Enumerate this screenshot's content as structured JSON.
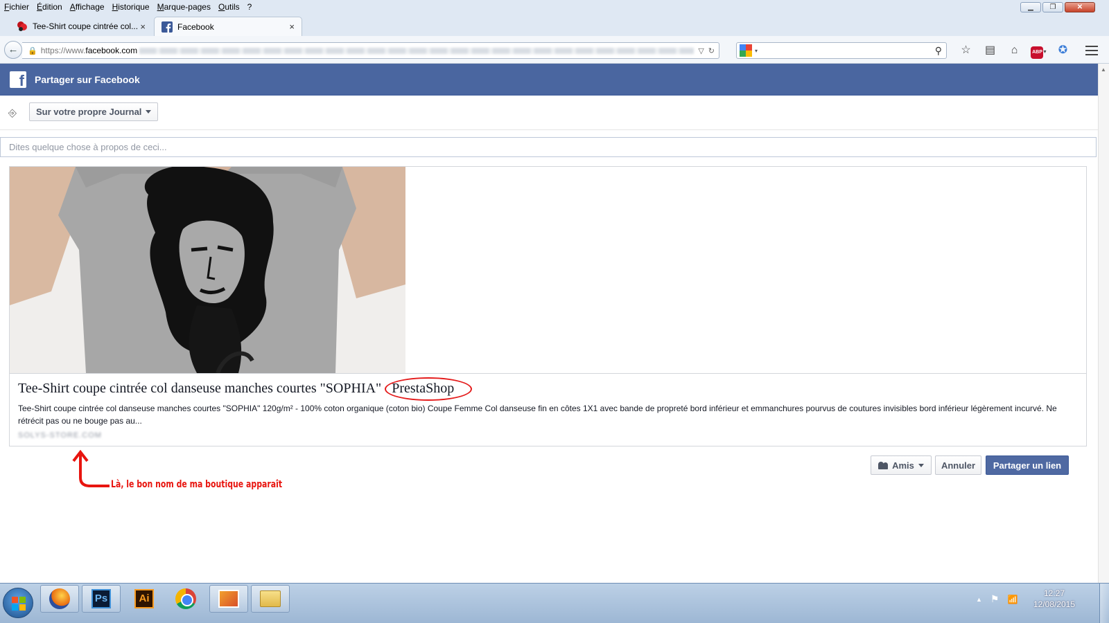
{
  "browser": {
    "menu": [
      "Fichier",
      "Édition",
      "Affichage",
      "Historique",
      "Marque-pages",
      "Outils",
      "?"
    ],
    "tabs": [
      {
        "label": "Tee-Shirt coupe cintrée col...",
        "close": "×"
      },
      {
        "label": "Facebook",
        "close": "×"
      }
    ],
    "new_tab": "+",
    "url_prefix": "https://www.",
    "url_host": "facebook.com",
    "url_rest": "/dialog/share.php?u=http%3A%2F%2F...tee-shirt-coupe-cintree-col-danseuse-manches-courtes-sophia",
    "search_value": ""
  },
  "dialog": {
    "header_title": "Partager sur Facebook",
    "audience_select": "Sur votre propre Journal",
    "comment_placeholder": "Dites quelque chose à propos de ceci...",
    "preview": {
      "title": "Tee-Shirt coupe cintrée col danseuse manches courtes \"SOPHIA\"",
      "shop_name": "PrestaShop",
      "description": "Tee-Shirt coupe cintrée col danseuse manches courtes \"SOPHIA\" 120g/m² - 100% coton organique (coton bio) Coupe Femme Col danseuse fin en côtes 1X1 avec bande de propreté bord inférieur et emmanchures pourvus de coutures invisibles bord inférieur légèrement incurvé. Ne rétrécit pas ou ne bouge pas au...",
      "domain": "SOLYS-STORE.COM"
    },
    "privacy_button": "Amis",
    "cancel_button": "Annuler",
    "share_button": "Partager un lien"
  },
  "annotation": {
    "text": "Là, le bon nom de ma boutique apparaît",
    "color": "#e8150f"
  },
  "taskbar": {
    "clock_time": "12:27",
    "clock_date": "12/08/2015",
    "apps": [
      "firefox-icon",
      "photoshop-icon",
      "illustrator-icon",
      "chrome-icon",
      "app-icon",
      "folder-icon"
    ],
    "ps_label": "Ps",
    "ai_label": "Ai"
  },
  "colors": {
    "facebook_blue": "#4a66a0",
    "share_button": "#4f69a2",
    "highlight_red": "#e41b1b"
  }
}
